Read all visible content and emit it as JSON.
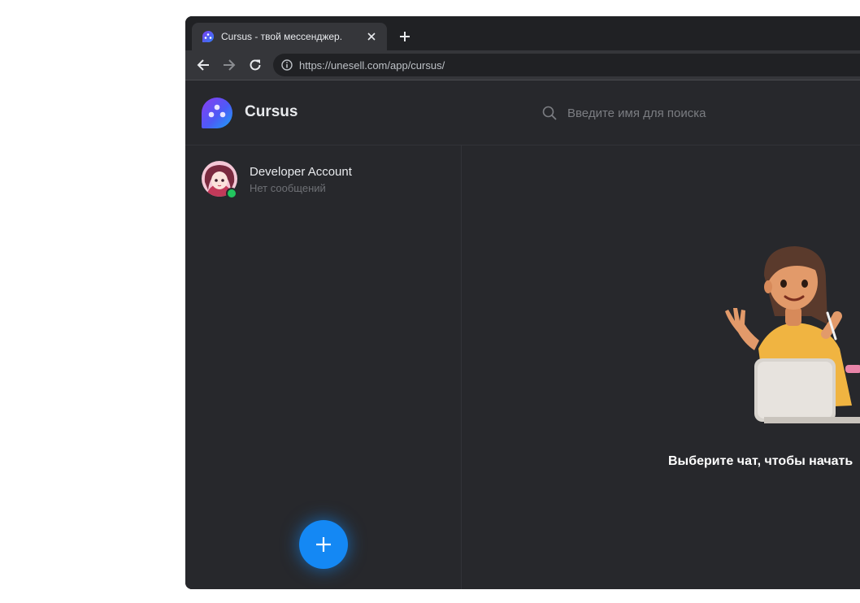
{
  "browser": {
    "tab": {
      "title": "Cursus - твой мессенджер.",
      "favicon": "cursus-logo-icon",
      "close_icon": "close-icon"
    },
    "new_tab_icon": "plus-icon",
    "nav": {
      "back_icon": "arrow-left-icon",
      "forward_icon": "arrow-right-icon",
      "reload_icon": "reload-icon"
    },
    "omnibox": {
      "info_icon": "info-icon",
      "url": "https://unesell.com/app/cursus/"
    }
  },
  "app": {
    "name": "Cursus",
    "search": {
      "placeholder": "Введите имя для поиска",
      "value": ""
    },
    "contacts": [
      {
        "name": "Developer Account",
        "status": "Нет сообщений",
        "online": true
      }
    ],
    "fab_icon": "plus-icon",
    "empty_state": {
      "text": "Выберите чат, чтобы начать"
    }
  },
  "colors": {
    "accent": "#1488f4",
    "online": "#22c55e",
    "app_bg": "#27282c",
    "browser_bg": "#202124"
  }
}
